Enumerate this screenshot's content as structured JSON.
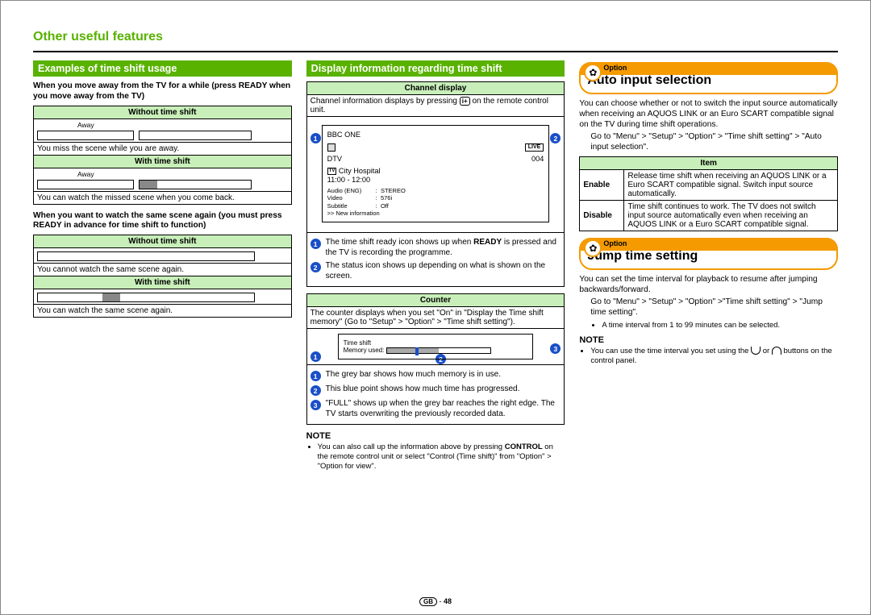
{
  "page_title": "Other useful features",
  "col1": {
    "heading": "Examples of time shift usage",
    "intro1": "When you move away from the TV for a while (press READY when you move away from the TV)",
    "t1": {
      "h1": "Without time shift",
      "away": "Away",
      "r1": "You miss the scene while you are away.",
      "h2": "With time shift",
      "r2": "You can watch the missed scene when you come back."
    },
    "intro2": "When you want to watch the same scene again (you must press READY in advance for time shift to function)",
    "t2": {
      "h1": "Without time shift",
      "r1": "You cannot watch the same scene again.",
      "h2": "With time shift",
      "r2": "You can watch the same scene again."
    }
  },
  "col2": {
    "heading": "Display information regarding time shift",
    "chd_head": "Channel display",
    "chd_desc_a": "Channel information displays by pressing ",
    "chd_desc_b": " on the remote control unit.",
    "ch": {
      "name": "BBC ONE",
      "live": "LIVE",
      "src": "DTV",
      "num": "004",
      "prog": "City Hospital",
      "tv_icon": "TV",
      "time": "11:00 - 12:00",
      "l1a": "Audio (ENG)",
      "l1b": "STEREO",
      "l2a": "Video",
      "l2b": "576i",
      "l3a": "Subtitle",
      "l3b": "Off",
      "l4": ">> New information"
    },
    "items1": {
      "i1a": "The time shift ready icon shows up when ",
      "i1b": "READY",
      "i1c": " is pressed and the TV is recording the programme.",
      "i2": "The status icon shows up depending on what is shown on the screen."
    },
    "cnt_head": "Counter",
    "cnt_desc": "The counter displays when you set \"On\" in \"Display the Time shift memory\" (Go to \"Setup\" > \"Option\" > \"Time shift setting\").",
    "cnt_labels": {
      "a": "Time shift",
      "b": "Memory used:"
    },
    "items2": {
      "i1": "The grey bar shows how much memory is in use.",
      "i2": "This blue point shows how much time has progressed.",
      "i3": "\"FULL\" shows up when the grey bar reaches the right edge. The TV starts overwriting the previously recorded data."
    },
    "note_head": "NOTE",
    "note_a": "You can also call up the information above by pressing ",
    "note_b": "CONTROL",
    "note_c": " on the remote control unit or select \"Control (Time shift)\" from \"Option\" > \"Option for view\"."
  },
  "col3": {
    "opt1_tag": "Option",
    "opt1_title": "Auto input selection",
    "opt1_p1": "You can choose whether or not to switch the input source automatically when receiving an AQUOS LINK or an Euro SCART compatible signal on the TV during time shift operations.",
    "opt1_p2": "Go to \"Menu\" > \"Setup\" > \"Option\" > \"Time shift setting\" > \"Auto input selection\".",
    "tbl": {
      "h": "Item",
      "r1a": "Enable",
      "r1b": "Release time shift when receiving an AQUOS LINK or a Euro SCART compatible signal. Switch input source automatically.",
      "r2a": "Disable",
      "r2b": "Time shift continues to work. The TV does not switch input source automatically even when receiving an AQUOS LINK or a Euro SCART compatible signal."
    },
    "opt2_tag": "Option",
    "opt2_title": "Jump time setting",
    "opt2_p1": "You can set the time interval for playback to resume after jumping backwards/forward.",
    "opt2_p2": "Go to \"Menu\" > \"Setup\" > \"Option\" >\"Time shift setting\" > \"Jump time setting\".",
    "opt2_b1": "A time interval from 1 to 99 minutes can be selected.",
    "note_head": "NOTE",
    "note_a": "You can use the time interval you set using the ",
    "note_b": " or ",
    "note_c": " buttons on the control panel."
  },
  "footer": {
    "gb": "GB",
    "dash": " - ",
    "page": "48"
  }
}
